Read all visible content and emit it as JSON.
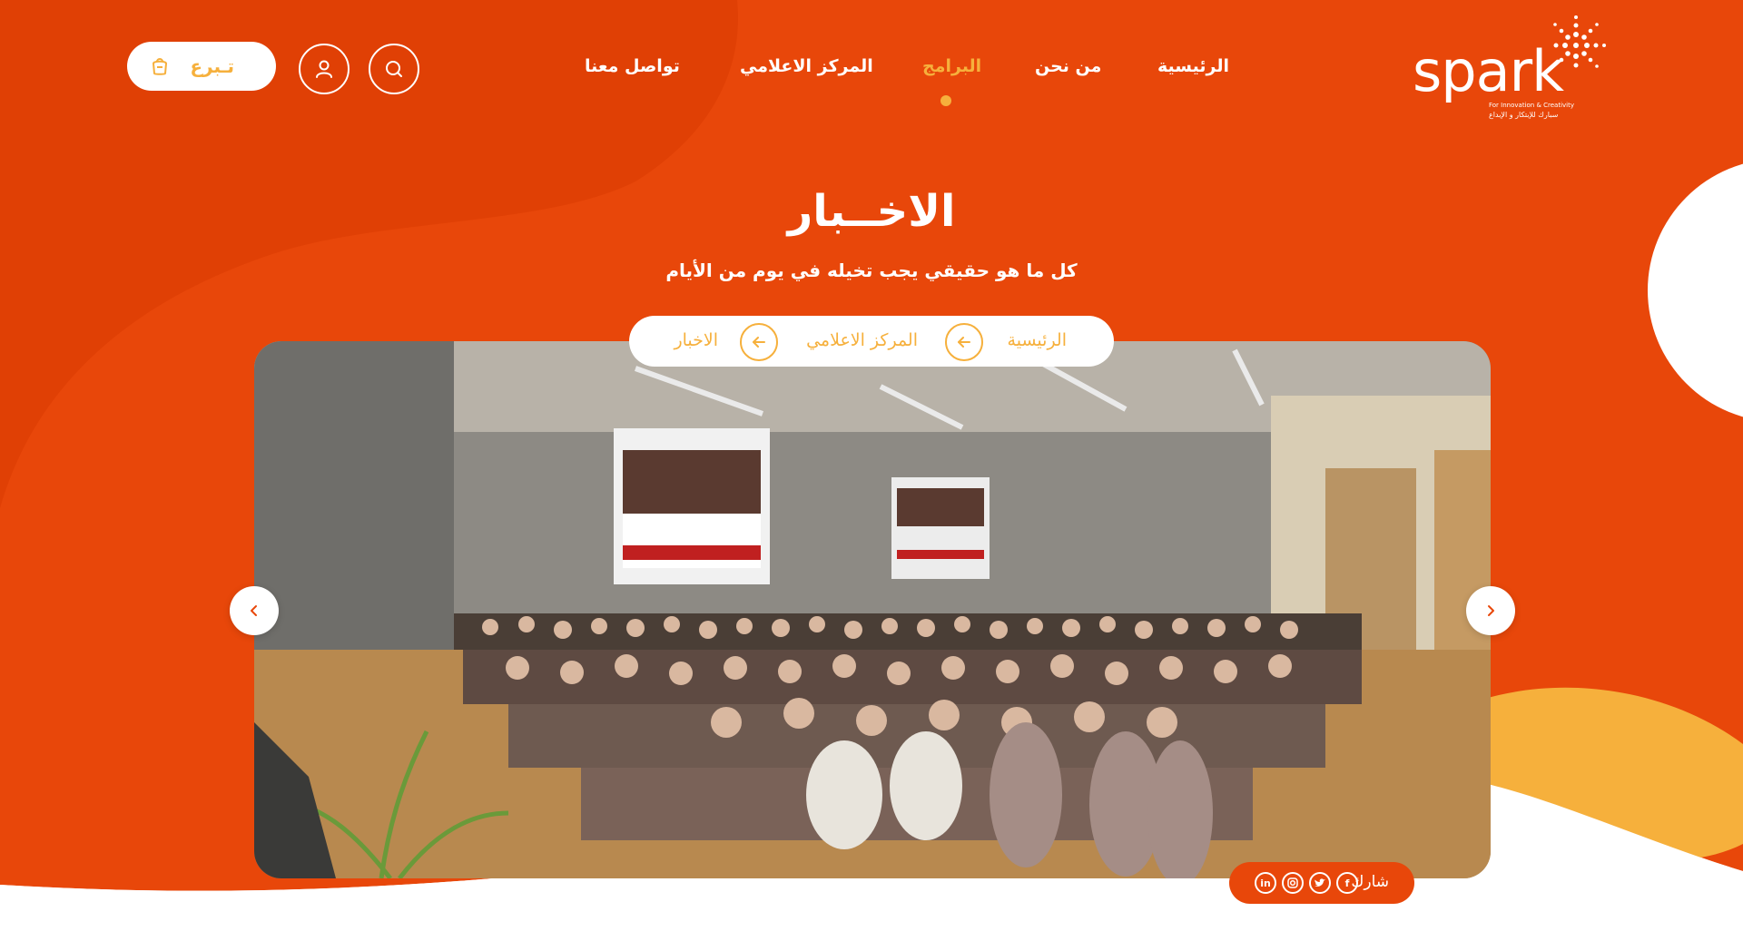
{
  "brand": {
    "name": "spark",
    "tagline_en": "For Innovation & Creativity",
    "tagline_ar": "سبارك للإبتكار و الإبداع",
    "colors": {
      "primary": "#e8470a",
      "accent": "#f6b03c",
      "white": "#ffffff"
    }
  },
  "nav": {
    "items": [
      {
        "label": "الرئيسية"
      },
      {
        "label": "من نحن"
      },
      {
        "label": "البرامج"
      },
      {
        "label": "المركز الاعلامي"
      },
      {
        "label": "تواصل معنا"
      }
    ],
    "active": "البرامج"
  },
  "header_actions": {
    "search_icon": "search-icon",
    "user_icon": "user-icon",
    "donate_label": "تـبرع",
    "donate_icon": "donation-bag-icon"
  },
  "hero": {
    "title": "الاخــبار",
    "subtitle": "كل ما هو حقيقي يجب تخيله في يوم من الأيام"
  },
  "breadcrumb": {
    "items": [
      {
        "label": "الرئيسية"
      },
      {
        "label": "المركز الاعلامي"
      },
      {
        "label": "الاخبار"
      }
    ],
    "separator_icon": "arrow-left-icon"
  },
  "slider": {
    "prev_icon": "chevron-left-icon",
    "next_icon": "chevron-right-icon"
  },
  "share": {
    "label": "شارك",
    "icons": [
      "facebook-icon",
      "twitter-icon",
      "instagram-icon",
      "linkedin-icon"
    ],
    "facebook": "f",
    "linkedin": "in"
  }
}
